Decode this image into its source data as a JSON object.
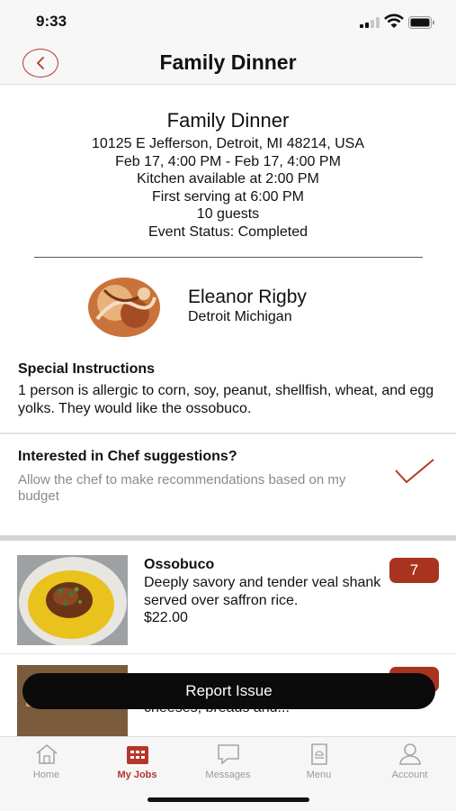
{
  "status": {
    "time": "9:33"
  },
  "nav": {
    "title": "Family Dinner"
  },
  "event": {
    "title": "Family Dinner",
    "address": "10125 E Jefferson, Detroit, MI 48214, USA",
    "dates": "Feb 17, 4:00 PM - Feb 17, 4:00 PM",
    "kitchen": "Kitchen available at 2:00 PM",
    "serving": "First serving at 6:00 PM",
    "guests": "10 guests",
    "status": "Event Status: Completed"
  },
  "host": {
    "name": "Eleanor Rigby",
    "location": "Detroit Michigan"
  },
  "instructions": {
    "title": "Special Instructions",
    "text": "1 person is allergic to corn, soy, peanut, shellfish, wheat, and egg yolks. They would like the ossobuco."
  },
  "suggestions": {
    "title": "Interested in Chef suggestions?",
    "subtitle": "Allow the chef to make recommendations based on my budget",
    "checked": true
  },
  "dishes": [
    {
      "name": "Ossobuco",
      "description": "Deeply savory and tender veal shank served over saffron rice.",
      "price": "$22.00",
      "quantity": "7"
    },
    {
      "name": "",
      "description": "A seasonal selection of local meats, cheeses, breads and...",
      "price": "",
      "quantity": ""
    }
  ],
  "report_button": "Report Issue",
  "tabs": [
    {
      "label": "Home",
      "icon": "home-icon",
      "active": false
    },
    {
      "label": "My Jobs",
      "icon": "calendar-icon",
      "active": true
    },
    {
      "label": "Messages",
      "icon": "chat-icon",
      "active": false
    },
    {
      "label": "Menu",
      "icon": "menu-book-icon",
      "active": false
    },
    {
      "label": "Account",
      "icon": "person-icon",
      "active": false
    }
  ],
  "colors": {
    "accent": "#b4372a",
    "badge": "#a8331f",
    "button": "#0b0b0b"
  }
}
